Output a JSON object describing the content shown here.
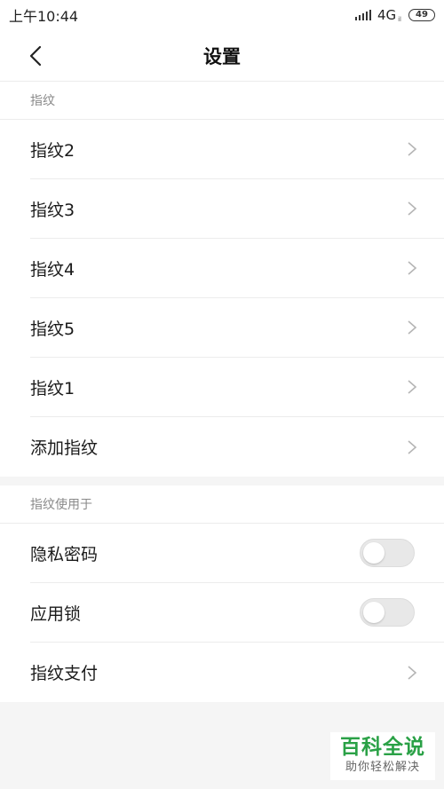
{
  "status_bar": {
    "time": "上午10:44",
    "network": "4G",
    "network_sub": "il",
    "battery": "49"
  },
  "header": {
    "title": "设置"
  },
  "fingerprints": {
    "section_label": "指纹",
    "items": [
      {
        "label": "指纹2"
      },
      {
        "label": "指纹3"
      },
      {
        "label": "指纹4"
      },
      {
        "label": "指纹5"
      },
      {
        "label": "指纹1"
      },
      {
        "label": "添加指纹"
      }
    ]
  },
  "usage": {
    "section_label": "指纹使用于",
    "privacy_password": {
      "label": "隐私密码",
      "enabled": false
    },
    "app_lock": {
      "label": "应用锁",
      "enabled": false
    },
    "payment": {
      "label": "指纹支付"
    }
  },
  "watermark": {
    "title": "百科全说",
    "subtitle": "助你轻松解决"
  },
  "colors": {
    "background": "#f5f5f5",
    "watermark_green": "#2aa146"
  }
}
